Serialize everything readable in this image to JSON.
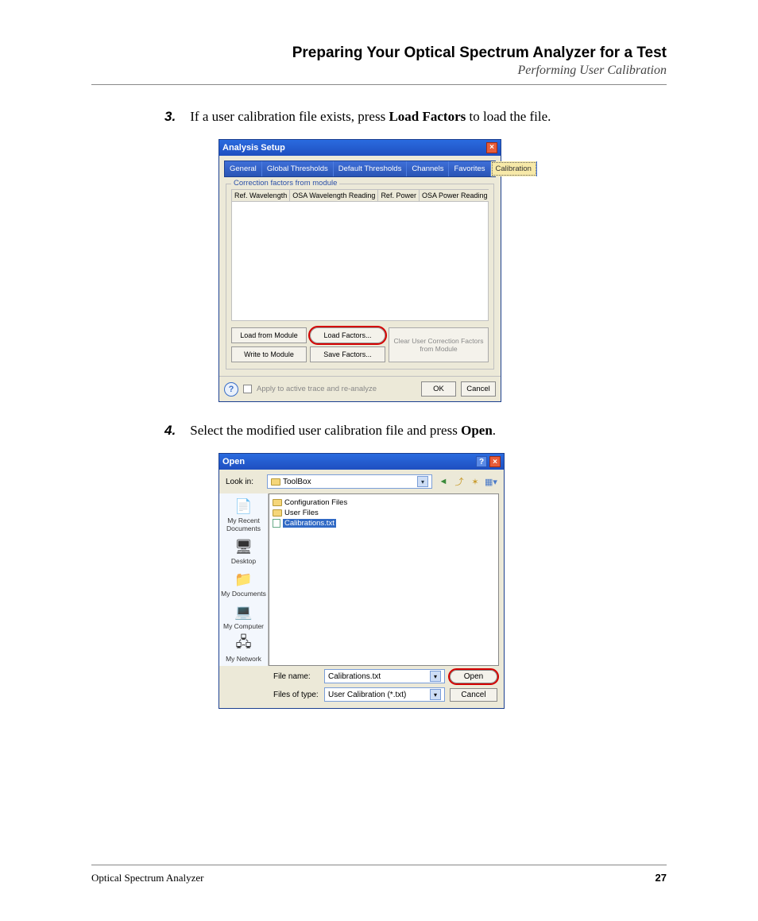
{
  "header": {
    "title": "Preparing Your Optical Spectrum Analyzer for a Test",
    "subtitle": "Performing User Calibration"
  },
  "steps": {
    "s3": {
      "num": "3.",
      "pre": "If a user calibration file exists, press ",
      "bold": "Load Factors",
      "post": " to load the file."
    },
    "s4": {
      "num": "4.",
      "pre": "Select the modified user calibration file and press ",
      "bold": "Open",
      "post": "."
    }
  },
  "dlg1": {
    "title": "Analysis Setup",
    "tabs": [
      "General",
      "Global Thresholds",
      "Default Thresholds",
      "Channels",
      "Favorites",
      "Calibration"
    ],
    "active_tab": 5,
    "group_label": "Correction factors from module",
    "cols": [
      "Ref. Wavelength",
      "OSA Wavelength Reading",
      "Ref. Power",
      "OSA Power Reading"
    ],
    "btns": {
      "load_module": "Load from Module",
      "load_factors": "Load Factors...",
      "write_module": "Write to Module",
      "save_factors": "Save Factors...",
      "clear": "Clear User Correction Factors from Module"
    },
    "footer": {
      "chk": "Apply to active trace and re-analyze",
      "ok": "OK",
      "cancel": "Cancel"
    }
  },
  "dlg2": {
    "title": "Open",
    "lookin_label": "Look in:",
    "lookin_value": "ToolBox",
    "places": [
      "My Recent Documents",
      "Desktop",
      "My Documents",
      "My Computer",
      "My Network"
    ],
    "files": {
      "f0": "Configuration Files",
      "f1": "User Files",
      "f2": "Calibrations.txt"
    },
    "filename_label": "File name:",
    "filename_value": "Calibrations.txt",
    "filetype_label": "Files of type:",
    "filetype_value": "User Calibration (*.txt)",
    "open": "Open",
    "cancel": "Cancel"
  },
  "footer": {
    "left": "Optical Spectrum Analyzer",
    "right": "27"
  }
}
